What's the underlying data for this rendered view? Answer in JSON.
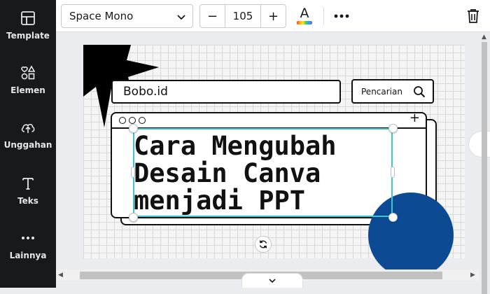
{
  "sidebar": {
    "items": [
      {
        "label": "Template",
        "icon": "layout-icon"
      },
      {
        "label": "Elemen",
        "icon": "shapes-icon"
      },
      {
        "label": "Unggahan",
        "icon": "cloud-upload-icon"
      },
      {
        "label": "Teks",
        "icon": "text-icon"
      },
      {
        "label": "Lainnya",
        "icon": "more-dots-icon"
      }
    ]
  },
  "toolbar": {
    "font_family": "Space Mono",
    "decrease_label": "−",
    "font_size": "105",
    "increase_label": "+",
    "text_color_label": "A",
    "more_label": "•••"
  },
  "canvas": {
    "search_text": "Bobo.id",
    "search_button_label": "Pencarian",
    "headline_lines": [
      "Cara Mengubah",
      "Desain Canva",
      "menjadi PPT"
    ],
    "window_plus": "+"
  },
  "colors": {
    "sidebar_bg": "#18191b",
    "selection": "#3ec6d0",
    "circle_blue": "#0c4b94"
  }
}
